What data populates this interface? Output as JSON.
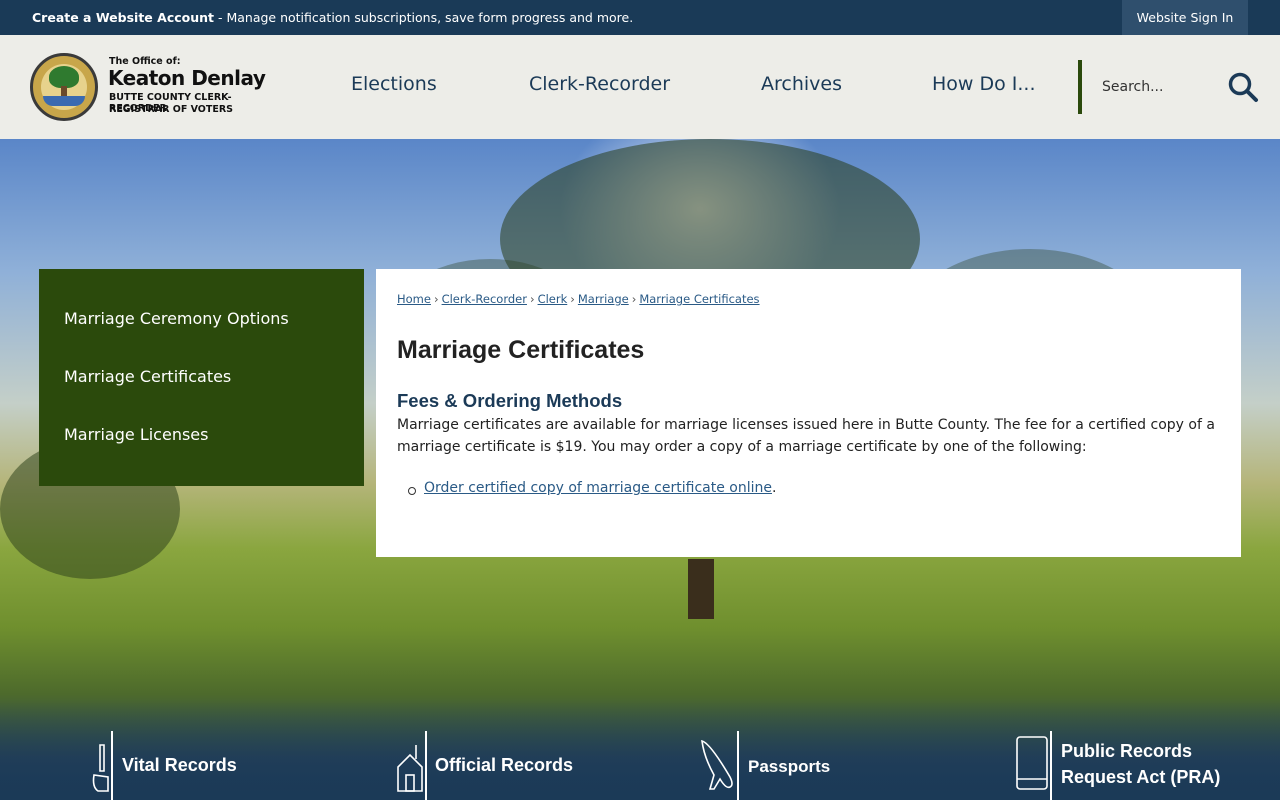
{
  "topbar": {
    "create_account": "Create a Website Account",
    "create_account_desc": " - Manage notification subscriptions, save form progress and more.",
    "sign_in": "Website Sign In"
  },
  "logo": {
    "office_of": "The Office of:",
    "name": "Keaton Denlay",
    "line1": "BUTTE COUNTY CLERK-RECORDER",
    "line2": "REGISTRAR OF VOTERS"
  },
  "nav": {
    "items": [
      {
        "label": "Elections"
      },
      {
        "label": "Clerk-Recorder"
      },
      {
        "label": "Archives"
      },
      {
        "label": "How Do I..."
      }
    ]
  },
  "search": {
    "placeholder": "Search..."
  },
  "sidebar": {
    "items": [
      {
        "label": "Marriage Ceremony Options"
      },
      {
        "label": "Marriage Certificates"
      },
      {
        "label": "Marriage Licenses"
      }
    ]
  },
  "breadcrumb": [
    {
      "label": "Home"
    },
    {
      "label": "Clerk-Recorder"
    },
    {
      "label": "Clerk"
    },
    {
      "label": "Marriage"
    },
    {
      "label": "Marriage Certificates"
    }
  ],
  "main": {
    "title": "Marriage Certificates",
    "section_heading": "Fees & Ordering Methods",
    "paragraph": "Marriage certificates are available for marriage licenses issued here in Butte County. The fee for a certified copy of a marriage certificate is $19. You may order a copy of a marriage certificate by one of the following:",
    "order_link": "Order certified copy of marriage certificate online",
    "order_link_suffix": "."
  },
  "quick_links": [
    {
      "label": "Vital Records",
      "icon": "pen-hand-icon"
    },
    {
      "label": "Official Records",
      "icon": "building-icon"
    },
    {
      "label": "Passports",
      "icon": "airplane-icon"
    },
    {
      "label_line1": "Public Records",
      "label_line2": "Request Act (PRA)",
      "icon": "book-icon"
    }
  ],
  "colors": {
    "topbar": "#1a3a57",
    "brand_green": "#2b4a0c",
    "nav_text": "#1b3a57",
    "link": "#2a5a86"
  }
}
